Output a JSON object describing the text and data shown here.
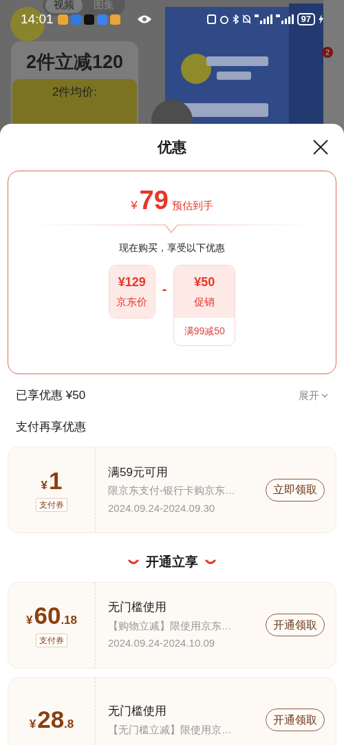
{
  "status_bar": {
    "time": "14:01",
    "battery": "97"
  },
  "background": {
    "tabs": [
      {
        "label": "视频",
        "selected": true
      },
      {
        "label": "图集",
        "selected": false
      }
    ],
    "promo_title": "2件立减120",
    "promo_sub": "2件均价:",
    "badge": "2"
  },
  "sheet": {
    "title": "优惠",
    "summary": {
      "currency": "¥",
      "price": "79",
      "price_note": "预估到手",
      "intro": "现在购买，享受以下优惠",
      "operator": "-",
      "items": [
        {
          "amount": "¥129",
          "label": "京东价"
        },
        {
          "amount": "¥50",
          "label": "促销",
          "detail": "满99减50"
        }
      ]
    },
    "enjoyed": {
      "label": "已享优惠 ¥50",
      "toggle": "展开"
    },
    "section_pay": "支付再享优惠",
    "section_open": "开通立享",
    "coupons": [
      {
        "currency": "¥",
        "amount": "1",
        "tag": "支付券",
        "title": "满59元可用",
        "desc": "限京东支付-银行卡购京东…",
        "date": "2024.09.24-2024.09.30",
        "button": "立即领取"
      },
      {
        "currency": "¥",
        "amount": "60",
        "decimal": ".18",
        "tag": "支付券",
        "title": "无门槛使用",
        "desc": "【购物立减】限使用京东…",
        "date": "2024.09.24-2024.10.09",
        "button": "开通领取"
      },
      {
        "currency": "¥",
        "amount": "28",
        "decimal": ".8",
        "title": "无门槛使用",
        "desc": "【无门槛立减】限使用京…",
        "button": "开通领取"
      }
    ]
  }
}
